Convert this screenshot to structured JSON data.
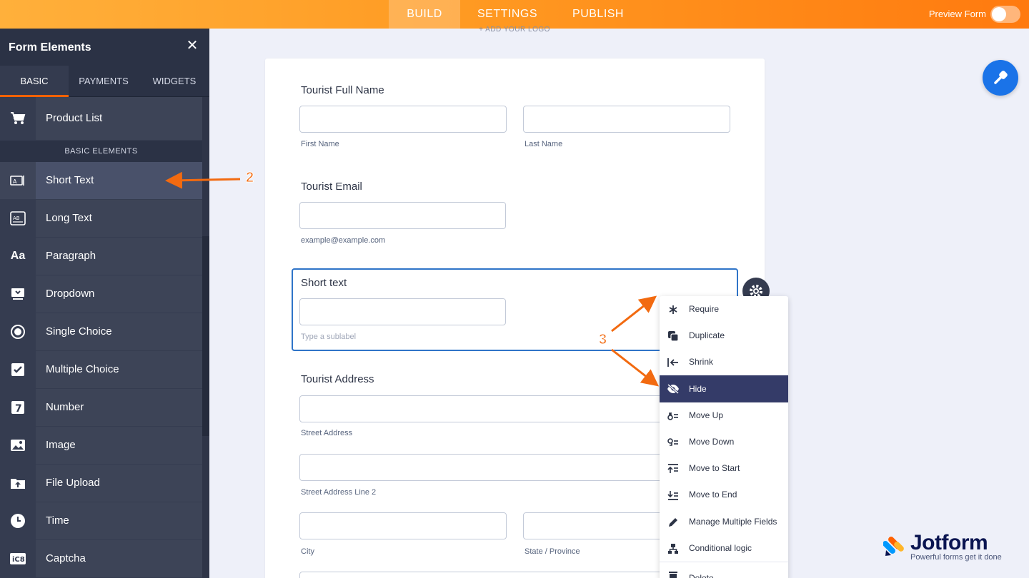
{
  "topbar": {
    "tabs": [
      "BUILD",
      "SETTINGS",
      "PUBLISH"
    ],
    "active_tab": "BUILD",
    "preview_label": "Preview Form"
  },
  "sidebar": {
    "title": "Form Elements",
    "tabs": [
      "BASIC",
      "PAYMENTS",
      "WIDGETS"
    ],
    "active_tab": "BASIC",
    "top_item": {
      "label": "Product List",
      "icon": "cart-icon"
    },
    "section_label": "BASIC ELEMENTS",
    "items": [
      {
        "label": "Short Text",
        "icon": "short-text-icon"
      },
      {
        "label": "Long Text",
        "icon": "long-text-icon"
      },
      {
        "label": "Paragraph",
        "icon": "paragraph-icon"
      },
      {
        "label": "Dropdown",
        "icon": "dropdown-icon"
      },
      {
        "label": "Single Choice",
        "icon": "radio-icon"
      },
      {
        "label": "Multiple Choice",
        "icon": "checkbox-icon"
      },
      {
        "label": "Number",
        "icon": "number-icon"
      },
      {
        "label": "Image",
        "icon": "image-icon"
      },
      {
        "label": "File Upload",
        "icon": "file-upload-icon"
      },
      {
        "label": "Time",
        "icon": "clock-icon"
      },
      {
        "label": "Captcha",
        "icon": "captcha-icon"
      }
    ]
  },
  "form": {
    "logo_hint": "+ ADD YOUR LOGO",
    "full_name": {
      "label": "Tourist Full Name",
      "first_sub": "First Name",
      "last_sub": "Last Name"
    },
    "email": {
      "label": "Tourist Email",
      "sub": "example@example.com"
    },
    "short_text": {
      "label": "Short text",
      "sub": "Type a sublabel"
    },
    "address": {
      "label": "Tourist Address",
      "street_sub": "Street Address",
      "street2_sub": "Street Address Line 2",
      "city_sub": "City",
      "state_sub": "State / Province"
    }
  },
  "context_menu": {
    "items": [
      {
        "label": "Require",
        "icon": "asterisk-icon"
      },
      {
        "label": "Duplicate",
        "icon": "duplicate-icon"
      },
      {
        "label": "Shrink",
        "icon": "shrink-icon"
      },
      {
        "label": "Hide",
        "icon": "eye-slash-icon"
      },
      {
        "label": "Move Up",
        "icon": "move-up-icon"
      },
      {
        "label": "Move Down",
        "icon": "move-down-icon"
      },
      {
        "label": "Move to Start",
        "icon": "move-to-start-icon"
      },
      {
        "label": "Move to End",
        "icon": "move-to-end-icon"
      },
      {
        "label": "Manage Multiple Fields",
        "icon": "pencil-icon"
      },
      {
        "label": "Conditional logic",
        "icon": "logic-icon"
      },
      {
        "label": "Delete",
        "icon": "trash-icon"
      }
    ],
    "active": "Hide"
  },
  "annotations": {
    "step2": "2",
    "step3": "3"
  },
  "brand": {
    "name": "Jotform",
    "tagline": "Powerful forms get it done"
  },
  "colors": {
    "accent": "#ff6100",
    "sidebar": "#3d4457",
    "selected_border": "#2f74c8",
    "menu_active": "#343b68",
    "fab": "#1a73e8"
  }
}
